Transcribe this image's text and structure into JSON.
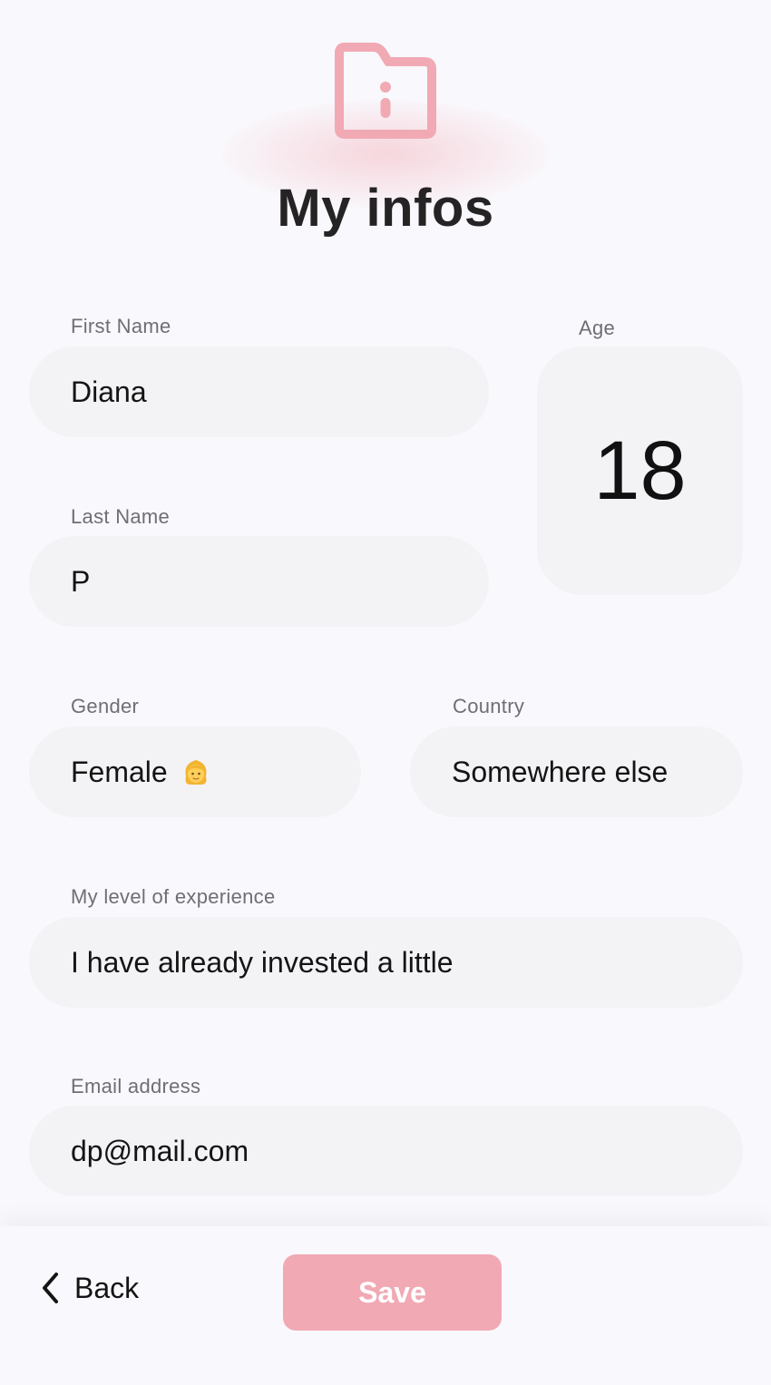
{
  "header": {
    "icon": "folder-info-icon",
    "title": "My infos",
    "accent_color": "#f1a9b4"
  },
  "form": {
    "first_name": {
      "label": "First Name",
      "value": "Diana"
    },
    "last_name": {
      "label": "Last Name",
      "value": "P"
    },
    "age": {
      "label": "Age",
      "value": "18"
    },
    "gender": {
      "label": "Gender",
      "value": "Female",
      "emoji": "woman-emoji"
    },
    "country": {
      "label": "Country",
      "value": "Somewhere else"
    },
    "experience": {
      "label": "My level of experience",
      "value": "I have already invested a little"
    },
    "email": {
      "label": "Email address",
      "value": "dp@mail.com"
    }
  },
  "footer": {
    "back_label": "Back",
    "back_icon": "chevron-left-icon",
    "save_label": "Save"
  }
}
